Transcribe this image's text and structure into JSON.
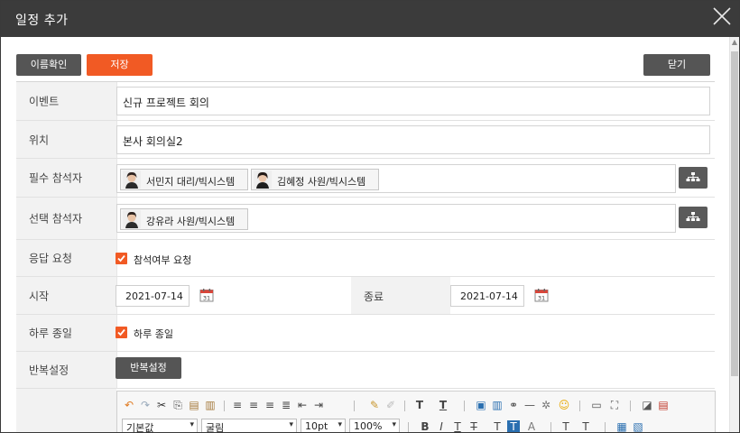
{
  "window": {
    "title": "일정 추가"
  },
  "top_buttons": {
    "check_name": "이름확인",
    "save": "저장",
    "close": "닫기"
  },
  "form": {
    "event": {
      "label": "이벤트",
      "value": "신규 프로젝트 회의"
    },
    "location": {
      "label": "위치",
      "value": "본사 회의실2"
    },
    "required": {
      "label": "필수 참석자",
      "attendees": [
        {
          "name": "서민지 대리/빅시스템"
        },
        {
          "name": "김혜정 사원/빅시스템"
        }
      ]
    },
    "optional": {
      "label": "선택 참석자",
      "attendees": [
        {
          "name": "강유라 사원/빅시스템"
        }
      ]
    },
    "response": {
      "label": "응답 요청",
      "checkbox_label": "참석여부 요청",
      "checked": true
    },
    "start": {
      "label": "시작",
      "date": "2021-07-14"
    },
    "end": {
      "label": "종료",
      "date": "2021-07-14"
    },
    "allday": {
      "label": "하루 종일",
      "checkbox_label": "하루 종일",
      "checked": true
    },
    "repeat": {
      "label": "반복설정",
      "button": "반복설정"
    }
  },
  "editor": {
    "font_style": "기본값",
    "font_family": "굴림",
    "font_size": "10pt",
    "zoom": "100%",
    "tools_row1": [
      "undo-icon",
      "redo-icon",
      "cut-icon",
      "copy-icon",
      "paste-icon",
      "paste-text-icon",
      "align-left-icon",
      "align-center-icon",
      "align-right-icon",
      "align-justify-icon",
      "outdent-icon",
      "indent-icon",
      "format-paint-icon",
      "clear-format-icon",
      "text-t-icon",
      "text-underline-t-icon",
      "image-icon",
      "chart-icon",
      "link-icon",
      "hr-icon",
      "special-char-icon",
      "emoji-icon",
      "page-break-icon",
      "fullscreen-icon",
      "preview-icon",
      "pdf-icon"
    ],
    "tools_row2": [
      "bold-icon",
      "italic-icon",
      "underline-icon",
      "strike-icon",
      "superscript-icon",
      "font-color-icon",
      "highlight-icon",
      "format-icon",
      "super-icon",
      "table-icon",
      "edit-table-icon"
    ],
    "accent_colors": {
      "orange": "#f15a24",
      "dark": "#3b3b3b"
    }
  }
}
